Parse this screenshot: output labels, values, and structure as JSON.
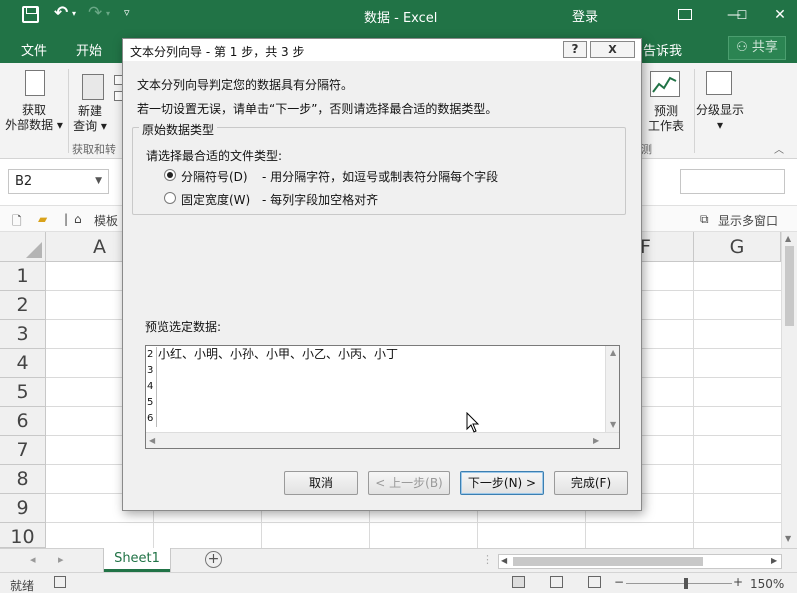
{
  "titlebar": {
    "doc_title": "数据  -  Excel",
    "login": "登录",
    "minimize": "—",
    "restore": "☐",
    "close": "✕"
  },
  "tabs": {
    "file": "文件",
    "home": "开始",
    "tell_me": "告诉我",
    "share": "共享"
  },
  "ribbon": {
    "get_external_data": [
      "获取",
      "外部数据"
    ],
    "new_query": [
      "新建",
      "查询"
    ],
    "group_get_transform": "获取和转",
    "forecast_sheet": [
      "预测",
      "工作表"
    ],
    "outline": "分级显示"
  },
  "formula_bar": {
    "name_box": "B2"
  },
  "docbar": {
    "template": "模板",
    "show_multi_window": "显示多窗口"
  },
  "grid": {
    "columns": [
      "A",
      "F",
      "G"
    ],
    "rows": [
      "1",
      "2",
      "3",
      "4",
      "5",
      "6",
      "7",
      "8",
      "9",
      "10"
    ]
  },
  "sheets": {
    "active": "Sheet1"
  },
  "statusbar": {
    "ready": "就绪",
    "zoom_minus": "−",
    "zoom_plus": "+",
    "zoom": "150%"
  },
  "dialog": {
    "title": "文本分列向导 - 第 1 步，共 3 步",
    "help": "?",
    "close": "X",
    "line1": "文本分列向导判定您的数据具有分隔符。",
    "line2": "若一切设置无误，请单击“下一步”，否则请选择最合适的数据类型。",
    "group_label": "原始数据类型",
    "choose_label": "请选择最合适的文件类型:",
    "option1_label": "分隔符号(D)",
    "option1_desc": "- 用分隔字符，如逗号或制表符分隔每个字段",
    "option2_label": "固定宽度(W)",
    "option2_desc": "- 每列字段加空格对齐",
    "preview_label": "预览选定数据:",
    "preview_rows": [
      "2",
      "3",
      "4",
      "5",
      "6"
    ],
    "preview_text": "小红、小明、小孙、小甲、小乙、小丙、小丁",
    "cancel": "取消",
    "back": "< 上一步(B)",
    "next": "下一步(N) >",
    "finish": "完成(F)"
  },
  "colors": {
    "excel_green": "#217346",
    "dialog_bg": "#f0f0f0",
    "ribbon_bg": "#f3f3f3"
  }
}
